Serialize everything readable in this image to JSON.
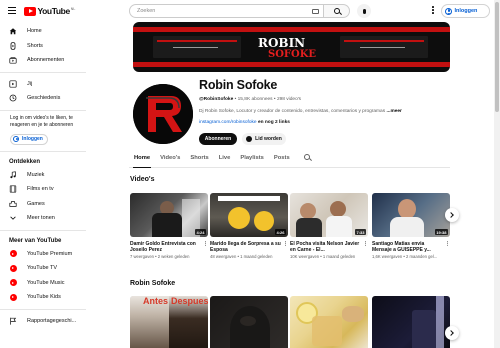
{
  "header": {
    "logo_text": "YouTube",
    "region_code": "NL",
    "search_placeholder": "Zoeken",
    "signin_label": "Inloggen"
  },
  "sidebar": {
    "primary": [
      {
        "label": "Home",
        "icon": "home-icon"
      },
      {
        "label": "Shorts",
        "icon": "shorts-icon"
      },
      {
        "label": "Abonnementen",
        "icon": "subscriptions-icon"
      }
    ],
    "secondary": [
      {
        "label": "Jij",
        "icon": "you-icon"
      },
      {
        "label": "Geschiedenis",
        "icon": "history-icon"
      }
    ],
    "signin_note": "Log in om video's te liken, te reageren en je te abonneren",
    "signin_label": "Inloggen",
    "explore_heading": "Ontdekken",
    "explore": [
      {
        "label": "Muziek",
        "icon": "music-icon"
      },
      {
        "label": "Films en tv",
        "icon": "film-icon"
      },
      {
        "label": "Games",
        "icon": "gaming-icon"
      },
      {
        "label": "Meer tonen",
        "icon": "chevron-down-icon"
      }
    ],
    "more_heading": "Meer van YouTube",
    "more": [
      {
        "label": "YouTube Premium"
      },
      {
        "label": "YouTube TV"
      },
      {
        "label": "YouTube Music"
      },
      {
        "label": "YouTube Kids"
      }
    ],
    "report": {
      "label": "Rapportagegeschi...",
      "icon": "flag-icon"
    }
  },
  "channel": {
    "banner_line1": "ROBIN",
    "banner_line2": "SOFOKE",
    "name": "Robin Sofoke",
    "handle": "@RobinSofoke",
    "subscribers": "15,8K abonnees",
    "videos_count": "298 video's",
    "description": "Dj Robin Sofoke, Locutor y creador de contenido, entrevistas, comentarios y programas",
    "description_more": "...meer",
    "link": "instagram.com/robinsofoke",
    "more_links": "en nog 2 links",
    "subscribe_label": "Abonneren",
    "join_label": "Lid worden"
  },
  "tabs": [
    {
      "label": "Home",
      "active": true
    },
    {
      "label": "Video's",
      "active": false
    },
    {
      "label": "Shorts",
      "active": false
    },
    {
      "label": "Live",
      "active": false
    },
    {
      "label": "Playlists",
      "active": false
    },
    {
      "label": "Posts",
      "active": false
    }
  ],
  "sections": {
    "videos_title": "Video's",
    "channel_title": "Robin Sofoke"
  },
  "videos": [
    {
      "title": "Damir Goldo Entrevista con Joseilo Perez",
      "meta": "7 weergaven • 2 weken geleden",
      "duration": "4:24"
    },
    {
      "title": "Marido llega de Sorpresa a su Esposa",
      "meta": "48 weergaven • 1 maand geleden",
      "duration": "4:26"
    },
    {
      "title": "El Pocha visita Nelson Javier en Carne - El...",
      "meta": "10K weergaven • 1 maand geleden",
      "duration": "7:33"
    },
    {
      "title": "Santiago Matias envia Mensaje a GUISEPPE y...",
      "meta": "1,6K weergaven • 2 maanden gel...",
      "duration": "19:38"
    }
  ],
  "row2": [
    {
      "overlay_left": "Antes",
      "overlay_right": "Despues"
    },
    {},
    {},
    {}
  ],
  "colors": {
    "brand_red": "#ff0000",
    "link_blue": "#065fd4",
    "banner_red": "#c21010"
  }
}
